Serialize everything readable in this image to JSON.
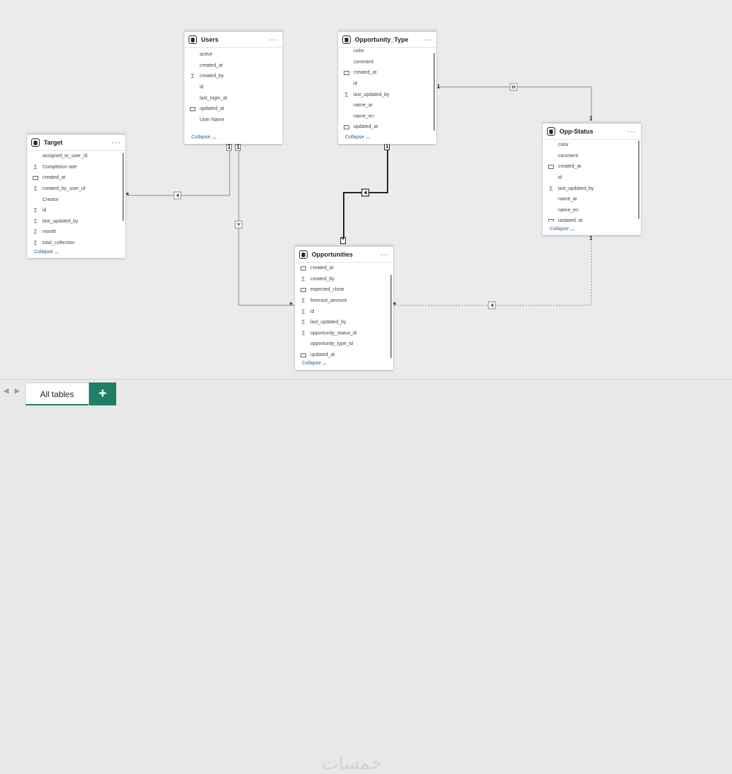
{
  "tables": {
    "users": {
      "title": "Users",
      "menu": "···",
      "collapse": "Collapse",
      "fields": [
        {
          "name": "active",
          "icon": ""
        },
        {
          "name": "created_at",
          "icon": ""
        },
        {
          "name": "created_by",
          "icon": "sigma"
        },
        {
          "name": "id",
          "icon": ""
        },
        {
          "name": "last_login_at",
          "icon": ""
        },
        {
          "name": "updated_at",
          "icon": "calendar"
        },
        {
          "name": "User Name",
          "icon": ""
        }
      ]
    },
    "opportunity_type": {
      "title": "Opportunity_Type",
      "menu": "···",
      "collapse": "Collapse",
      "fields": [
        {
          "name": "color",
          "icon": ""
        },
        {
          "name": "comment",
          "icon": ""
        },
        {
          "name": "created_at",
          "icon": "calendar"
        },
        {
          "name": "id",
          "icon": ""
        },
        {
          "name": "last_updated_by",
          "icon": "sigma"
        },
        {
          "name": "name_ar",
          "icon": ""
        },
        {
          "name": "name_en",
          "icon": ""
        },
        {
          "name": "updated_at",
          "icon": "calendar"
        }
      ]
    },
    "target": {
      "title": "Target",
      "menu": "···",
      "collapse": "Collapse",
      "fields": [
        {
          "name": "assigned_to_user_id",
          "icon": ""
        },
        {
          "name": "Completion rate",
          "icon": "sigma"
        },
        {
          "name": "created_at",
          "icon": "calendar"
        },
        {
          "name": "created_by_user_id",
          "icon": "sigma"
        },
        {
          "name": "Creator",
          "icon": ""
        },
        {
          "name": "id",
          "icon": "sigma"
        },
        {
          "name": "last_updated_by",
          "icon": "sigma"
        },
        {
          "name": "month",
          "icon": "sigma"
        },
        {
          "name": "total_collection",
          "icon": "sigma"
        }
      ]
    },
    "opp_status": {
      "title": "Opp-Status",
      "menu": "···",
      "collapse": "Collapse",
      "fields": [
        {
          "name": "color",
          "icon": ""
        },
        {
          "name": "comment",
          "icon": ""
        },
        {
          "name": "created_at",
          "icon": "calendar"
        },
        {
          "name": "id",
          "icon": ""
        },
        {
          "name": "last_updated_by",
          "icon": "sigma"
        },
        {
          "name": "name_ar",
          "icon": ""
        },
        {
          "name": "name_en",
          "icon": ""
        },
        {
          "name": "updated_at",
          "icon": "calendar"
        }
      ]
    },
    "opportunities": {
      "title": "Opportunities",
      "menu": "···",
      "collapse": "Collapse",
      "fields": [
        {
          "name": "created_at",
          "icon": "calendar"
        },
        {
          "name": "created_by",
          "icon": "sigma"
        },
        {
          "name": "expected_close",
          "icon": "calendar"
        },
        {
          "name": "forecast_amount",
          "icon": "sigma"
        },
        {
          "name": "id",
          "icon": "sigma"
        },
        {
          "name": "last_updated_by",
          "icon": "sigma"
        },
        {
          "name": "opportunity_status_id",
          "icon": "sigma"
        },
        {
          "name": "opportunity_type_id",
          "icon": ""
        },
        {
          "name": "updated_at",
          "icon": "calendar"
        }
      ]
    }
  },
  "relationships": [
    {
      "from": "Users",
      "to": "Target",
      "from_card": "1",
      "to_card": "*",
      "cross_filter": "single"
    },
    {
      "from": "Users",
      "to": "Opportunities",
      "from_card": "1",
      "to_card": "*",
      "cross_filter": "single"
    },
    {
      "from": "Opportunity_Type",
      "to": "Opportunities",
      "from_card": "1",
      "to_card": "*",
      "cross_filter": "single"
    },
    {
      "from": "Opportunity_Type",
      "to": "Opp-Status",
      "from_card": "1",
      "to_card": "1",
      "cross_filter": "both"
    },
    {
      "from": "Opp-Status",
      "to": "Opportunities",
      "from_card": "1",
      "to_card": "*",
      "cross_filter": "single"
    }
  ],
  "labels": {
    "one": "1",
    "many": "*"
  },
  "footer": {
    "tab_label": "All tables",
    "add_label": "+",
    "prev": "◀",
    "next": "▶",
    "watermark": "خمسات"
  },
  "colors": {
    "tab_accent": "#1e7f66",
    "line": "#8a8a8a",
    "selected_line": "#222222"
  }
}
